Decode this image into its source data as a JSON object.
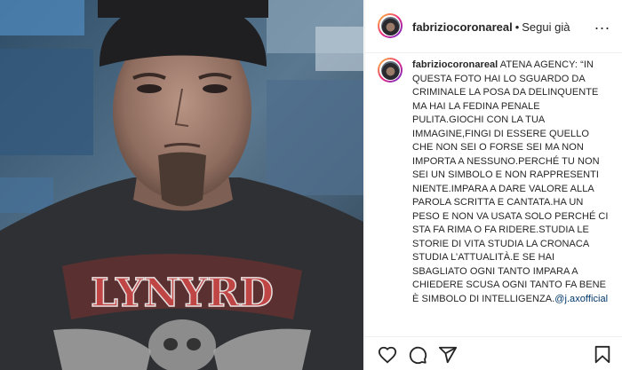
{
  "post": {
    "username": "fabriziocoronareal",
    "separator": "•",
    "follow_label": "Segui già",
    "more_label": "...",
    "caption_username": "fabriziocoronareal",
    "caption_text": "ATENA AGENCY: “IN QUESTA FOTO HAI LO SGUARDO DA CRIMINALE LA POSA DA DELINQUENTE MA HAI LA FEDINA PENALE PULITA.GIOCHI CON LA TUA IMMAGINE,FINGI DI ESSERE QUELLO CHE NON SEI O FORSE SEI MA NON IMPORTA A NESSUNO.PERCHÉ TU NON SEI UN SIMBOLO E NON RAPPRESENTI NIENTE.IMPARA A DARE VALORE ALLA PAROLA SCRITTA E CANTATA.HA UN PESO E NON VA USATA SOLO PERCHÉ CI STA FA RIMA O FA RIDERE.STUDIA LE STORIE DI VITA STUDIA LA CRONACA STUDIA L’ATTUALITÀ.E SE HAI SBAGLIATO OGNI TANTO IMPARA A CHIEDERE SCUSA OGNI TANTO FA BENE È SIMBOLO DI INTELLIGENZA.",
    "mention": "@j.axofficial"
  },
  "photo": {
    "shirt_text": "LYNYRD"
  },
  "icons": {
    "like": "heart-icon",
    "comment": "comment-icon",
    "share": "share-icon",
    "save": "bookmark-icon"
  }
}
